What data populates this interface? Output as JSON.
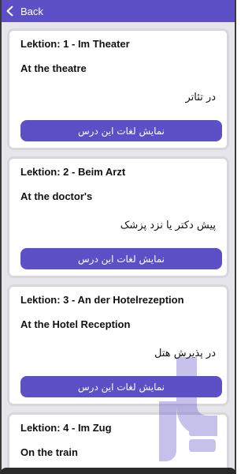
{
  "nav": {
    "back_label": "Back"
  },
  "lessons": [
    {
      "title": "Lektion: 1 - Im Theater",
      "translation": "At the theatre",
      "persian": "در تئاتر",
      "button_label": "نمایش لغات این درس"
    },
    {
      "title": "Lektion: 2 - Beim Arzt",
      "translation": "At the doctor's",
      "persian": "پیش دکتر یا نزد پزشک",
      "button_label": "نمایش لغات این درس"
    },
    {
      "title": "Lektion: 3 - An der Hotelrezeption",
      "translation": "At the Hotel Reception",
      "persian": "در پذیرش هتل",
      "button_label": "نمایش لغات این درس"
    },
    {
      "title": "Lektion: 4 - Im Zug",
      "translation": "On the train"
    }
  ],
  "colors": {
    "accent": "#5d4fc6",
    "background": "#e6e6ea",
    "card": "#ffffff"
  },
  "icons": {
    "back": "chevron-left-icon",
    "watermark": "brand-logo-watermark"
  }
}
